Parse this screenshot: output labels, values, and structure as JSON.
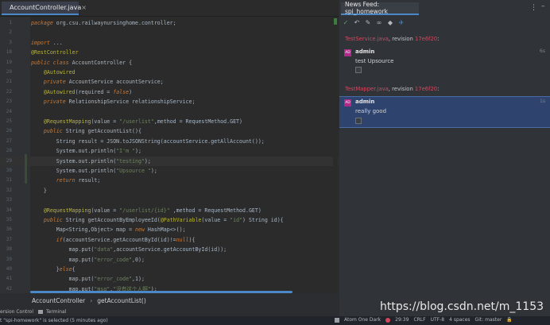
{
  "editor": {
    "tab_label": "AccountController.java",
    "tab_close": "×",
    "lines": [
      {
        "n": "1",
        "html": "<span class=\"kw\">package</span> org.csu.railwaynursinghome.controller;"
      },
      {
        "n": "2",
        "html": ""
      },
      {
        "n": "3",
        "html": "<span class=\"kw\">import</span> ..."
      },
      {
        "n": "18",
        "html": "<span class=\"an\">@RestController</span>"
      },
      {
        "n": "19",
        "html": "<span class=\"kw\">public class</span> AccountController {"
      },
      {
        "n": "20",
        "html": "    <span class=\"an\">@Autowired</span>"
      },
      {
        "n": "21",
        "html": "    <span class=\"kw\">private</span> AccountService accountService;"
      },
      {
        "n": "22",
        "html": "    <span class=\"an\">@Autowired</span>(required = <span class=\"kw\">false</span>)"
      },
      {
        "n": "23",
        "html": "    <span class=\"kw\">private</span> RelationshipService relationshipService;"
      },
      {
        "n": "24",
        "html": ""
      },
      {
        "n": "25",
        "html": "    <span class=\"an\">@RequestMapping</span>(value = <span class=\"st\">\"/userlist\"</span>,method = RequestMethod.GET)"
      },
      {
        "n": "26",
        "html": "    <span class=\"kw\">public</span> String getAccountList(){"
      },
      {
        "n": "27",
        "html": "        String result = JSON.toJSONString(accountService.getAllAccount());"
      },
      {
        "n": "28",
        "html": "        System.out.println(<span class=\"st\">\"I'm \"</span>);"
      },
      {
        "n": "29",
        "html": "        System.out.println(<span class=\"st\">\"testing\"</span>);"
      },
      {
        "n": "30",
        "html": "        System.out.println(<span class=\"st\">\"Upsource \"</span>);"
      },
      {
        "n": "31",
        "html": "        <span class=\"kw\">return</span> result;"
      },
      {
        "n": "32",
        "html": "    }"
      },
      {
        "n": "33",
        "html": ""
      },
      {
        "n": "34",
        "html": "    <span class=\"an\">@RequestMapping</span>(value = <span class=\"st\">\"/userlist/{id}\"</span> ,method = RequestMethod.GET)"
      },
      {
        "n": "35",
        "html": "    <span class=\"kw\">public</span> String getAccountByEmployeeId(<span class=\"an\">@PathVariable</span>(value = <span class=\"st\">\"id\"</span>) String id){"
      },
      {
        "n": "36",
        "html": "        Map&lt;String,Object&gt; map = <span class=\"kw\">new</span> HashMap&lt;&gt;();"
      },
      {
        "n": "37",
        "html": "        <span class=\"kw\">if</span>(accountService.getAccountById(id)!=<span class=\"kw\">null</span>){"
      },
      {
        "n": "38",
        "html": "            map.put(<span class=\"st\">\"data\"</span>,accountService.getAccountById(id));"
      },
      {
        "n": "39",
        "html": "            map.put(<span class=\"st\">\"error_code\"</span>,0);"
      },
      {
        "n": "40",
        "html": "        }<span class=\"kw\">else</span>{"
      },
      {
        "n": "41",
        "html": "            map.put(<span class=\"st\">\"error_code\"</span>,1);"
      },
      {
        "n": "42",
        "html": "            map.put(<span class=\"st\">\"msg\"</span>,<span class=\"st\">\"没有这个人啊\"</span>);"
      }
    ]
  },
  "breadcrumb": {
    "first": "AccountController",
    "sep": "›",
    "second": "getAccountList()"
  },
  "bottom_tools": {
    "version_control": "ersion Control",
    "terminal": "Terminal"
  },
  "status": {
    "message": "t \"spi-homework\" is selected (5 minutes ago)",
    "theme": "Atom One Dark",
    "time": "29:39",
    "line_sep": "CRLF",
    "encoding": "UTF-8",
    "indent": "4 spaces",
    "git": "Git: master"
  },
  "news_feed": {
    "tab_label": "News Feed: spi_homework",
    "menu": "⋮",
    "minimize": "–",
    "items": [
      {
        "file": "TestService.java",
        "sep": ", revision ",
        "rev": "17e6f20",
        "user": "admin",
        "text": "test Upsource",
        "ago": "6s",
        "avatar": "AD"
      },
      {
        "file": "TestMapper.java",
        "sep": ", revision ",
        "rev": "17e6f20",
        "user": "admin",
        "text": "really good",
        "ago": "1s",
        "avatar": "AD"
      }
    ]
  },
  "watermark": "https://blog.csdn.net/m_1153"
}
